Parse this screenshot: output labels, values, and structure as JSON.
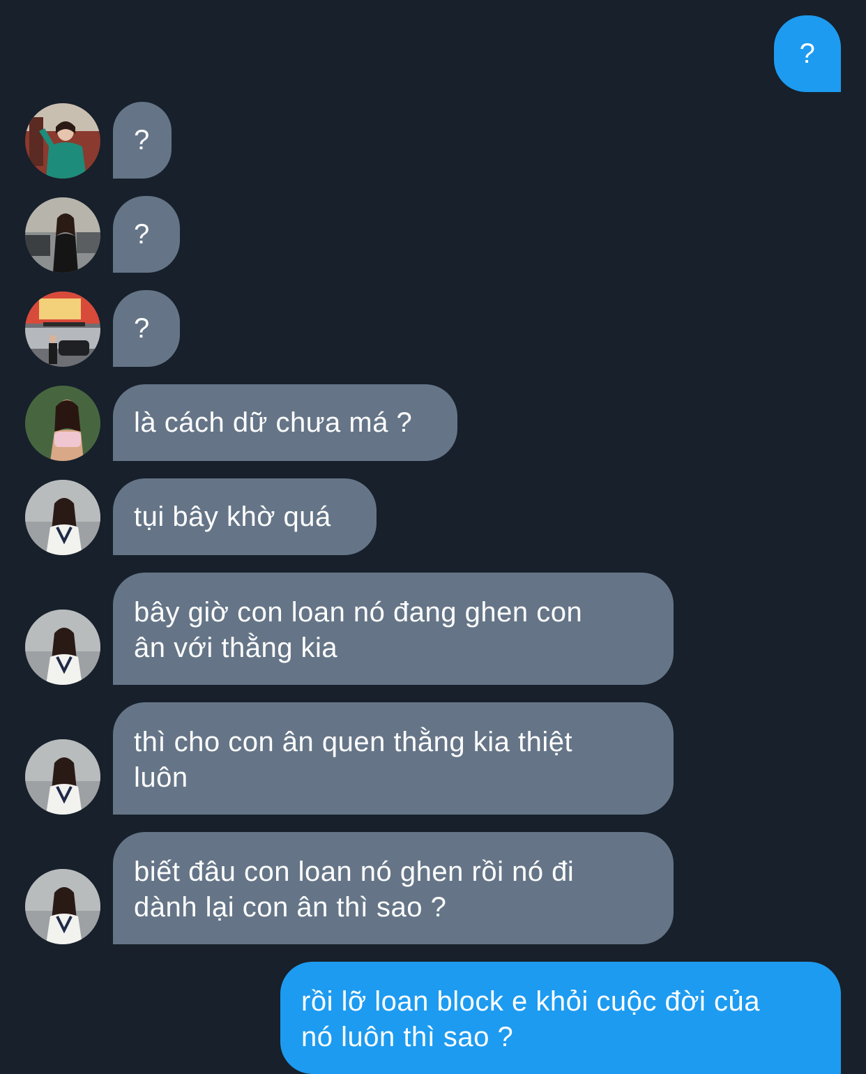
{
  "conversation": {
    "messages": [
      {
        "direction": "outgoing",
        "text": "?"
      },
      {
        "direction": "incoming",
        "avatar": "woman-green-dress-avatar",
        "text": "?"
      },
      {
        "direction": "incoming",
        "avatar": "woman-black-outfit-street-avatar",
        "text": "?"
      },
      {
        "direction": "incoming",
        "avatar": "woman-storefront-avatar",
        "text": "?"
      },
      {
        "direction": "incoming",
        "avatar": "woman-pink-top-avatar",
        "text": "là cách dữ chưa má ?"
      },
      {
        "direction": "incoming",
        "avatar": "woman-white-vest-avatar",
        "text": "tụi bây khờ quá"
      },
      {
        "direction": "incoming",
        "avatar": "woman-white-vest-avatar",
        "text": "bây giờ con loan nó đang ghen con\nân với thằng kia"
      },
      {
        "direction": "incoming",
        "avatar": "woman-white-vest-avatar",
        "text": "thì cho con ân quen thằng kia thiệt\nluôn"
      },
      {
        "direction": "incoming",
        "avatar": "woman-white-vest-avatar",
        "text": "biết đâu con loan nó ghen rồi nó đi\ndành lại con ân thì sao ?"
      },
      {
        "direction": "outgoing",
        "text": "rồi lỡ loan block e khỏi cuộc đời của\nnó luôn thì sao ?"
      }
    ]
  },
  "colors": {
    "background": "#17202b",
    "incoming_bubble": "#657587",
    "outgoing_bubble": "#1d9bf0",
    "text": "#ffffff"
  }
}
